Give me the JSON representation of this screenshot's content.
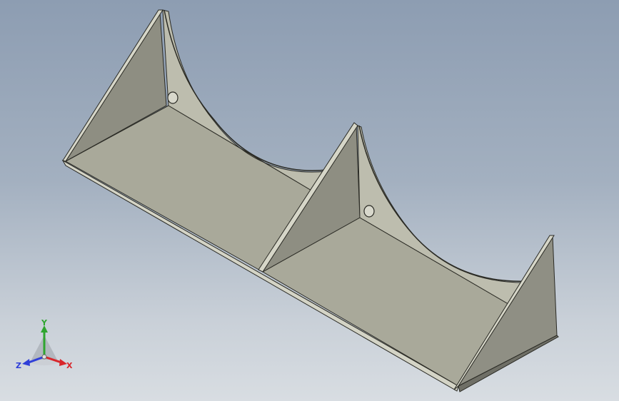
{
  "triad": {
    "x_label": "X",
    "y_label": "Y",
    "z_label": "Z",
    "x_color": "#d8262b",
    "y_color": "#2fa52f",
    "z_color": "#2f3fd8"
  },
  "model": {
    "part": "double-saddle-bracket",
    "face_color_light": "#b7b7a8",
    "face_color_mid": "#a6a697",
    "face_color_dark": "#8a8a7d",
    "edge_color": "#2a2a24"
  }
}
